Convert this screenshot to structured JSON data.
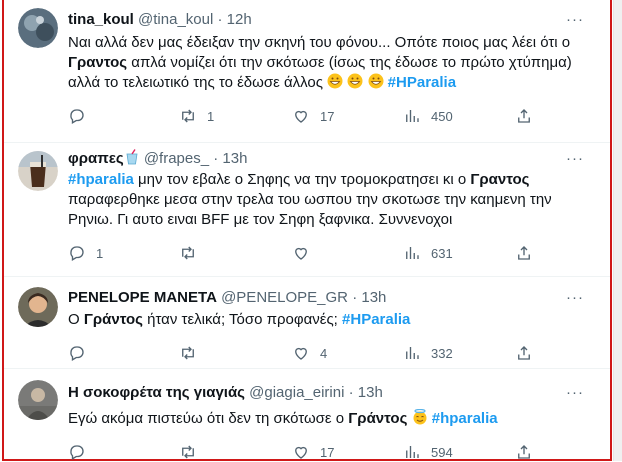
{
  "tweets": [
    {
      "name": "tina_koul",
      "handle": "@tina_koul",
      "dot": "·",
      "time": "12h",
      "text_parts": [
        "Ναι αλλά δεν μας έδειξαν την σκηνή του φόνου... Οπότε ποιος μας λέει ότι ο ",
        "Γραντος",
        " απλά νομίζει ότι την σκότωσε (ίσως της έδωσε το πρώτο χτύπημα) αλλά το τελειωτικό της το έδωσε άλλος ",
        "#HParalia"
      ],
      "reply_count": "",
      "retweet_count": "1",
      "like_count": "17",
      "view_count": "450"
    },
    {
      "name": "φραπες",
      "handle": "@frapes_",
      "dot": "·",
      "time": "13h",
      "text_parts": [
        "#hparalia",
        " μην τον εβαλε ο Σηφης να την τρομοκρατησει κι ο ",
        "Γραντος",
        " παραφερθηκε μεσα στην τρελα του ωσπου την σκοτωσε την καημενη την Ρηνιω. Γι αυτο ειναι BFF με τον Σηφη ξαφνικα. Συννενοχοι"
      ],
      "reply_count": "1",
      "retweet_count": "",
      "like_count": "",
      "view_count": "631"
    },
    {
      "name": "PENELOPE ΜΑΝΕΤΑ",
      "handle": "@PENELOPE_GR",
      "dot": "·",
      "time": "13h",
      "text_parts": [
        "Ο ",
        "Γράντος",
        " ήταν τελικά; Τόσο προφανές; ",
        "#HParalia"
      ],
      "reply_count": "",
      "retweet_count": "",
      "like_count": "4",
      "view_count": "332"
    },
    {
      "name": "Η σοκοφρέτα της γιαγιάς",
      "handle": "@giagia_eirini",
      "dot": "·",
      "time": "13h",
      "text_parts": [
        "Εγώ ακόμα πιστεύω ότι δεν τη σκότωσε ο ",
        "Γράντος",
        " ",
        "#hparalia"
      ],
      "reply_count": "",
      "retweet_count": "",
      "like_count": "17",
      "view_count": "594"
    }
  ],
  "icons": {
    "more": "more-icon",
    "reply": "reply-icon",
    "retweet": "retweet-icon",
    "like": "like-icon",
    "views": "views-icon",
    "share": "share-icon",
    "grin_emoji": "grinning-face-emoji",
    "halo_emoji": "smiling-face-with-halo-emoji",
    "drink_emoji": "cup-with-straw-emoji"
  },
  "more_label": "···",
  "colors": {
    "accent": "#1d9bf0",
    "secondary_text": "#536471",
    "frame": "#d01818"
  }
}
